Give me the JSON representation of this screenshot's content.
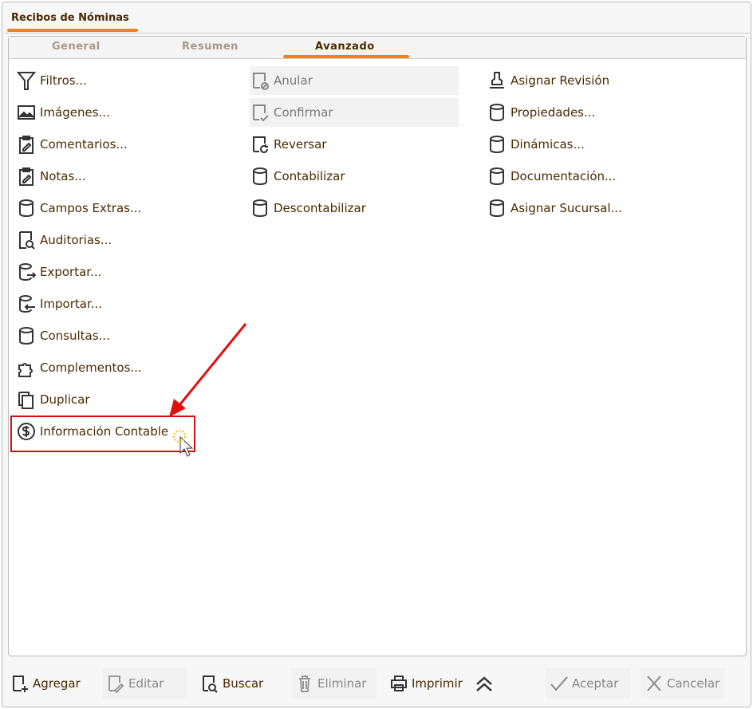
{
  "window": {
    "title": "Recibos de Nóminas"
  },
  "tabs": [
    {
      "label": "General"
    },
    {
      "label": "Resumen"
    },
    {
      "label": "Avanzado",
      "active": true
    }
  ],
  "col1": [
    {
      "label": "Filtros...",
      "icon": "filter-icon"
    },
    {
      "label": "Imágenes...",
      "icon": "image-icon"
    },
    {
      "label": "Comentarios...",
      "icon": "clipboard-edit-icon"
    },
    {
      "label": "Notas...",
      "icon": "clipboard-edit-icon"
    },
    {
      "label": "Campos Extras...",
      "icon": "database-icon"
    },
    {
      "label": "Auditorias...",
      "icon": "audit-icon"
    },
    {
      "label": "Exportar...",
      "icon": "database-export-icon"
    },
    {
      "label": "Importar...",
      "icon": "database-import-icon"
    },
    {
      "label": "Consultas...",
      "icon": "database-icon"
    },
    {
      "label": "Complementos...",
      "icon": "puzzle-icon"
    },
    {
      "label": "Duplicar",
      "icon": "copy-icon"
    },
    {
      "label": "Información Contable",
      "icon": "dollar-icon"
    }
  ],
  "col2": [
    {
      "label": "Anular",
      "icon": "cancel-doc-icon",
      "disabled": true
    },
    {
      "label": "Confirmar",
      "icon": "confirm-doc-icon",
      "disabled": true
    },
    {
      "label": "Reversar",
      "icon": "reverse-doc-icon"
    },
    {
      "label": "Contabilizar",
      "icon": "database-icon"
    },
    {
      "label": "Descontabilizar",
      "icon": "database-icon"
    }
  ],
  "col3": [
    {
      "label": "Asignar Revisión",
      "icon": "stamp-icon"
    },
    {
      "label": "Propiedades...",
      "icon": "database-icon"
    },
    {
      "label": "Dinámicas...",
      "icon": "database-icon"
    },
    {
      "label": "Documentación...",
      "icon": "database-icon"
    },
    {
      "label": "Asignar Sucursal...",
      "icon": "database-icon"
    }
  ],
  "footer": {
    "agregar": "Agregar",
    "editar": "Editar",
    "buscar": "Buscar",
    "eliminar": "Eliminar",
    "imprimir": "Imprimir",
    "aceptar": "Aceptar",
    "cancelar": "Cancelar"
  },
  "colors": {
    "accent": "#f08020",
    "text": "#4a2a00",
    "highlight": "#d01010"
  }
}
